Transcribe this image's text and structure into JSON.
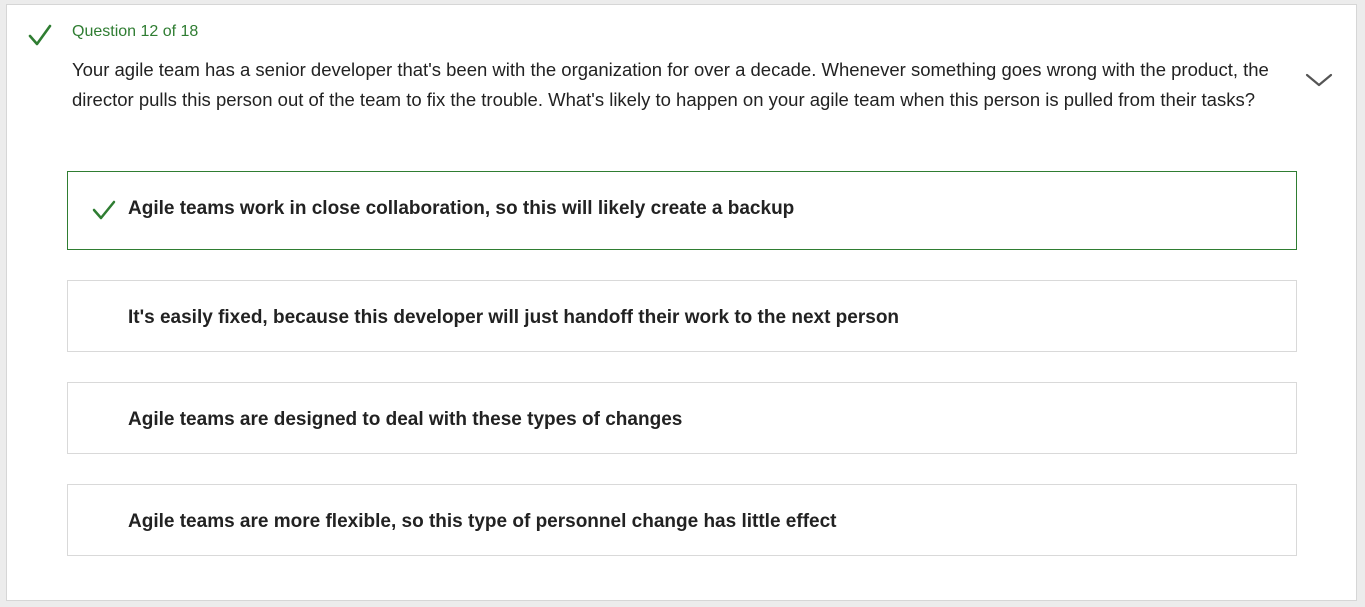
{
  "question": {
    "counter": "Question 12 of 18",
    "text": "Your agile team has a senior developer that's been with the organization for over a decade. Whenever something goes wrong with the product, the director pulls this person out of the team to fix the trouble. What's likely to happen on your agile team when this person is pulled from their tasks?",
    "status": "answered-correct",
    "status_icon": "checkmark-icon",
    "collapse_icon": "chevron-down-icon"
  },
  "options": [
    {
      "label": "Agile teams work in close collaboration, so this will likely create a backup",
      "selected": true,
      "correct": true
    },
    {
      "label": "It's easily fixed, because this developer will just handoff their work to the next person",
      "selected": false,
      "correct": false
    },
    {
      "label": "Agile teams are designed to deal with these types of changes",
      "selected": false,
      "correct": false
    },
    {
      "label": "Agile teams are more flexible, so this type of personnel change has little effect",
      "selected": false,
      "correct": false
    }
  ],
  "colors": {
    "accent_green": "#2f7d32",
    "text": "#222222",
    "border": "#d9d9d9",
    "background": "#ececec",
    "card": "#ffffff"
  }
}
